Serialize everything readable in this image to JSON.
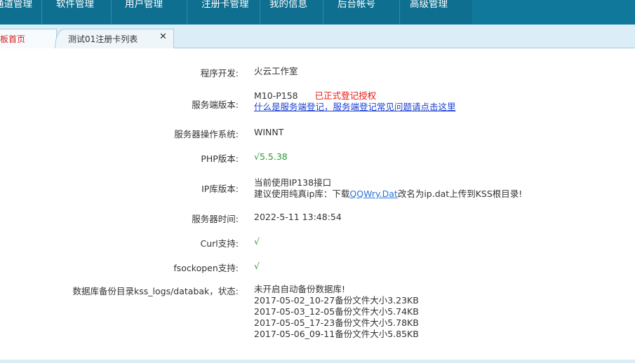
{
  "nav": {
    "items": [
      "通道管理",
      "软件管理",
      "用户管理",
      "注册卡管理",
      "我的信息",
      "后台帐号",
      "高级管理"
    ]
  },
  "tabs": {
    "home_label": "板首页",
    "list_label": "测试01注册卡列表",
    "close_glyph": "✕"
  },
  "info": {
    "developer_label": "程序开发:",
    "developer_value": "火云工作室",
    "server_version_label": "服务端版本:",
    "server_version_value": "M10-P158",
    "server_version_status": "已正式登记授权",
    "server_version_link": "什么是服务端登记，服务端登记常见问题请点击这里",
    "os_label": "服务器操作系统:",
    "os_value": "WINNT",
    "php_label": "PHP版本:",
    "php_value": "√5.5.38",
    "ip_label": "IP库版本:",
    "ip_line1": "当前使用IP138接口",
    "ip_line2_prefix": "建议使用纯真ip库：下载",
    "ip_line2_link": "QQWry.Dat",
    "ip_line2_suffix": "改名为ip.dat上传到KSS根目录!",
    "time_label": "服务器时间:",
    "time_value": "2022-5-11 13:48:54",
    "curl_label": "Curl支持:",
    "curl_value": "√",
    "fsock_label": "fsockopen支持:",
    "fsock_value": "√",
    "backup_label": "数据库备份目录kss_logs/databak，状态:",
    "backup_lines": [
      "未开启自动备份数据库!",
      "2017-05-02_10-27备份文件大小3.23KB",
      "2017-05-03_12-05备份文件大小5.74KB",
      "2017-05-05_17-23备份文件大小5.78KB",
      "2017-05-06_09-11备份文件大小5.85KB"
    ]
  },
  "colors": {
    "nav_bg": "#0e6f90",
    "tab_bg": "#dbedf6",
    "active_tab_text": "#d1221b",
    "status_red": "#e4140f",
    "check_green": "#2b9a33",
    "link_blue": "#1a3fd3"
  }
}
